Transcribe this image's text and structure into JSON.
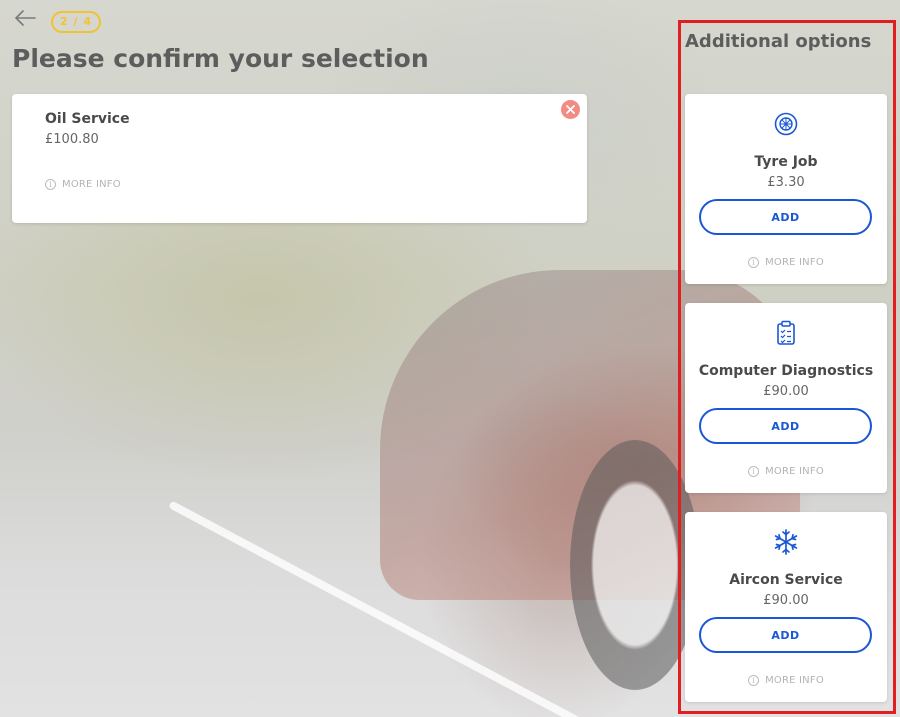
{
  "header": {
    "back_icon": "arrow-left-icon",
    "step": "2 / 4",
    "title": "Please confirm your selection"
  },
  "selected": {
    "name": "Oil Service",
    "price": "£100.80",
    "more_info": "MORE INFO",
    "remove_icon": "close-icon"
  },
  "additional": {
    "title": "Additional options",
    "items": [
      {
        "name": "Tyre Job",
        "price": "£3.30",
        "add_label": "ADD",
        "more_info": "MORE INFO",
        "icon": "tyre-icon"
      },
      {
        "name": "Computer Diagnostics",
        "price": "£90.00",
        "add_label": "ADD",
        "more_info": "MORE INFO",
        "icon": "clipboard-icon"
      },
      {
        "name": "Aircon Service",
        "price": "£90.00",
        "add_label": "ADD",
        "more_info": "MORE INFO",
        "icon": "snowflake-icon"
      }
    ]
  },
  "colors": {
    "accent": "#1a57d6",
    "step_badge": "#f1c232",
    "remove": "#f28b82",
    "highlight": "#e02020"
  }
}
